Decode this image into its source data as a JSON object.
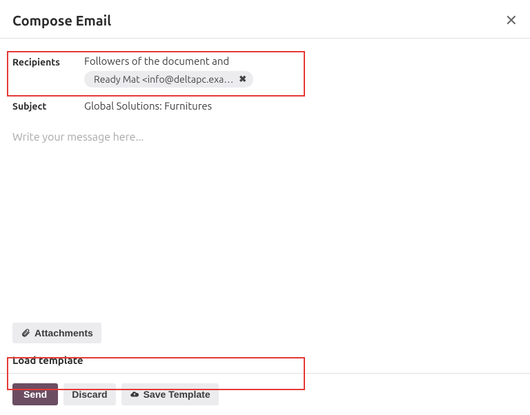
{
  "header": {
    "title": "Compose Email"
  },
  "fields": {
    "recipients_label": "Recipients",
    "recipients_text": "Followers of the document and",
    "recipients_chip": "Ready Mat <info@deltapc.exa…",
    "subject_label": "Subject",
    "subject_value": "Global Solutions: Furnitures",
    "message_placeholder": "Write your message here..."
  },
  "attachments": {
    "label": "Attachments"
  },
  "template": {
    "load_label": "Load template"
  },
  "footer": {
    "send": "Send",
    "discard": "Discard",
    "save_template": "Save Template"
  }
}
